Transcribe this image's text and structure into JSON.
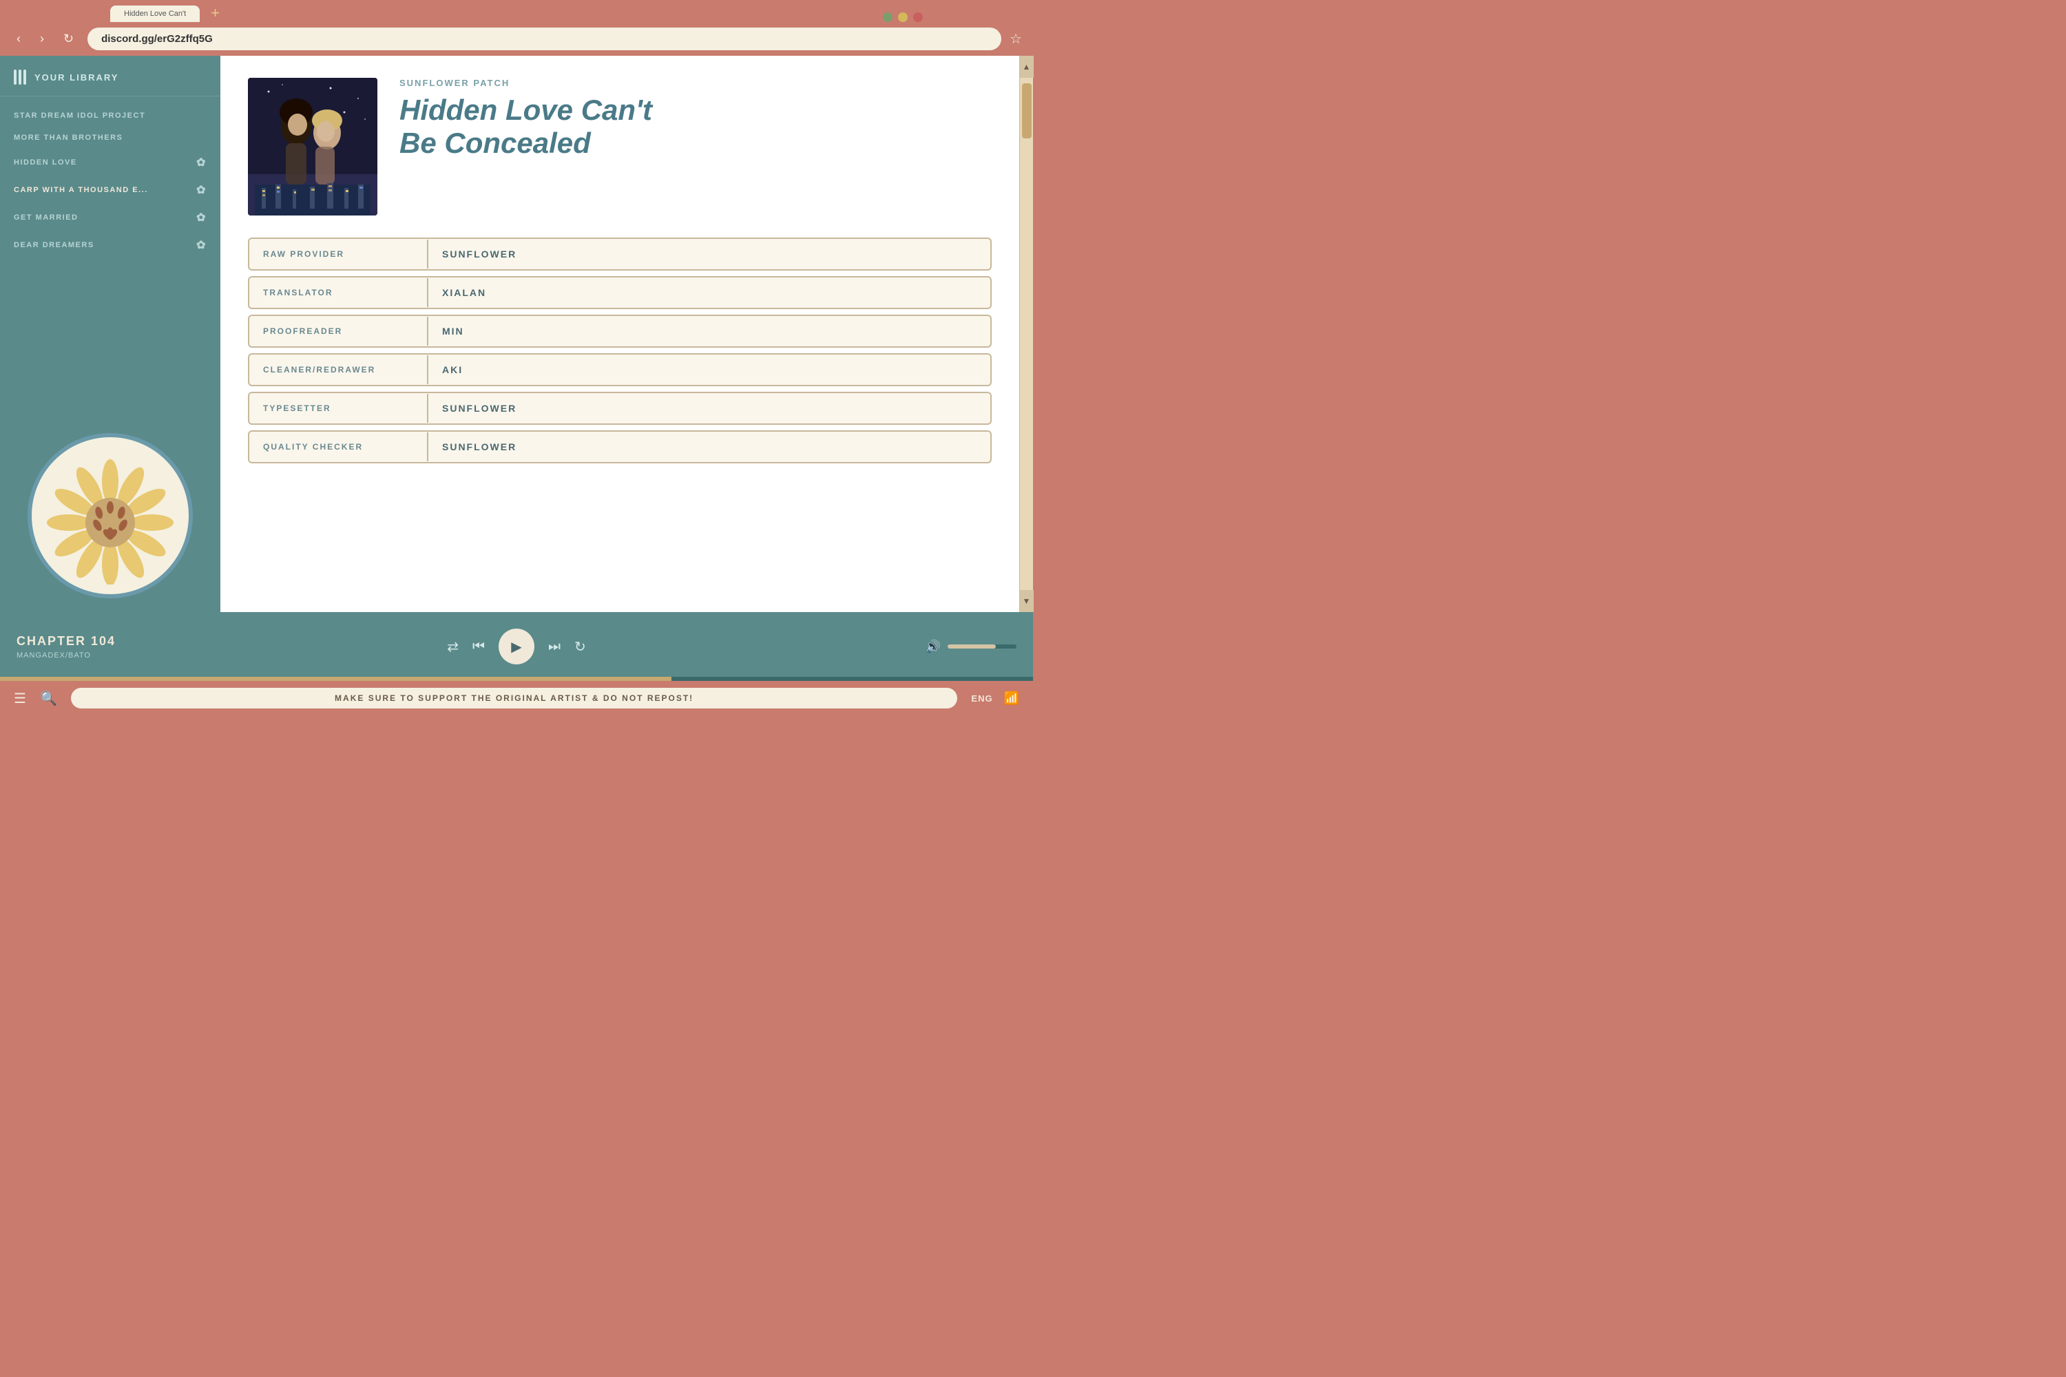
{
  "browser": {
    "url": "discord.gg/erG2zffq5G",
    "tabs": [
      {
        "label": "Hidden Love Can't Be Conc...",
        "active": true
      },
      {
        "label": "+",
        "isAdd": true
      }
    ],
    "window_controls": [
      "green",
      "yellow",
      "red"
    ]
  },
  "nav": {
    "back": "‹",
    "forward": "›",
    "refresh": "↻",
    "star": "☆"
  },
  "sidebar": {
    "header": "YOUR LIBRARY",
    "items": [
      {
        "label": "STAR DREAM IDOL PROJECT",
        "icon": false
      },
      {
        "label": "MORE THAN BROTHERS",
        "icon": false
      },
      {
        "label": "HIDDEN LOVE",
        "icon": true
      },
      {
        "label": "CARP WITH A THOUSAND E...",
        "icon": true
      },
      {
        "label": "GET MARRIED",
        "icon": true
      },
      {
        "label": "DEAR DREAMERS",
        "icon": true
      }
    ]
  },
  "manga": {
    "group": "SUNFLOWER PATCH",
    "title_line1": "Hidden Love Can't",
    "title_line2": "Be Concealed",
    "cover_alt": "Hidden Love Can't Be Concealed cover"
  },
  "credits": [
    {
      "label": "RAW PROVIDER",
      "value": "SUNFLOWER"
    },
    {
      "label": "TRANSLATOR",
      "value": "XIALAN"
    },
    {
      "label": "PROOFREADER",
      "value": "MIN"
    },
    {
      "label": "CLEANER/REDRAWER",
      "value": "AKI"
    },
    {
      "label": "TYPESETTER",
      "value": "SUNFLOWER"
    },
    {
      "label": "QUALITY CHECKER",
      "value": "SUNFLOWER"
    }
  ],
  "player": {
    "chapter": "CHAPTER 104",
    "source": "MANGADEX/BATO"
  },
  "status_bar": {
    "message": "MAKE SURE TO SUPPORT THE ORIGINAL ARTIST & DO NOT REPOST!",
    "language": "ENG"
  }
}
